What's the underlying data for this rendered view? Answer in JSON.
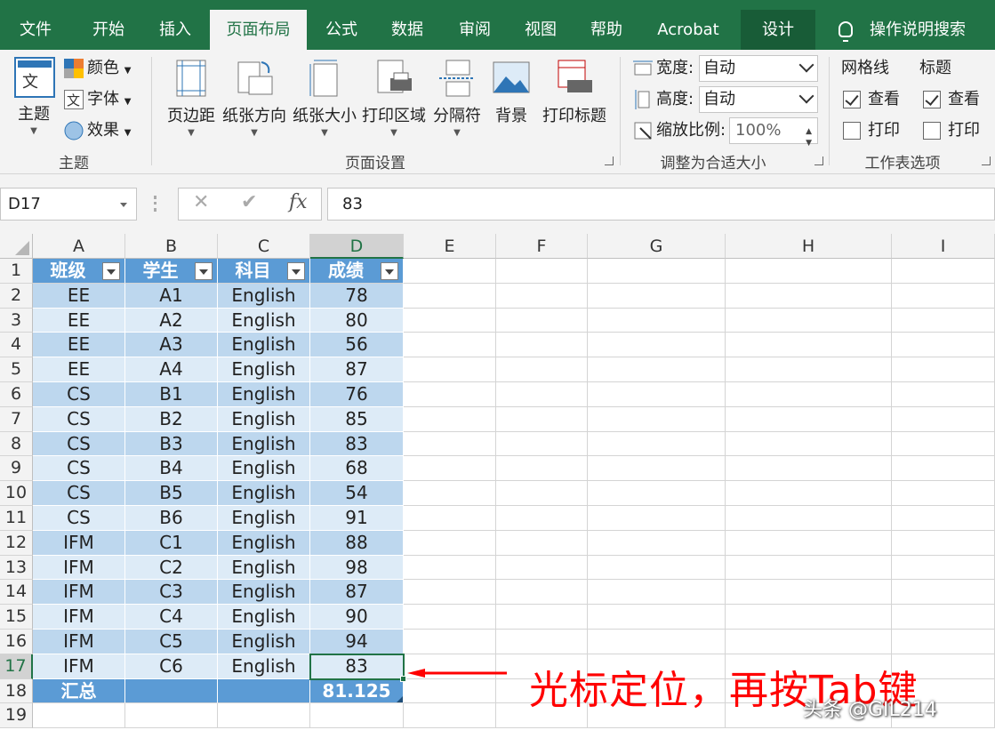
{
  "tabs": [
    {
      "label": "文件"
    },
    {
      "label": "开始"
    },
    {
      "label": "插入"
    },
    {
      "label": "页面布局"
    },
    {
      "label": "公式"
    },
    {
      "label": "数据"
    },
    {
      "label": "审阅"
    },
    {
      "label": "视图"
    },
    {
      "label": "帮助"
    },
    {
      "label": "Acrobat"
    },
    {
      "label": "设计"
    }
  ],
  "tell_me": "操作说明搜索",
  "ribbon": {
    "theme": {
      "themes": "主题",
      "colors": "颜色",
      "fonts": "字体",
      "effects": "效果",
      "group": "主题"
    },
    "page_setup": {
      "margins": "页边距",
      "orientation": "纸张方向",
      "size": "纸张大小",
      "print_area": "打印区域",
      "breaks": "分隔符",
      "background": "背景",
      "print_titles": "打印标题",
      "group": "页面设置"
    },
    "scale": {
      "width_label": "宽度:",
      "width_value": "自动",
      "height_label": "高度:",
      "height_value": "自动",
      "scale_label": "缩放比例:",
      "scale_value": "100%",
      "group": "调整为合适大小"
    },
    "sheet_options": {
      "gridlines": "网格线",
      "headings": "标题",
      "view": "查看",
      "print": "打印",
      "group": "工作表选项"
    }
  },
  "formula_bar": {
    "name_box": "D17",
    "formula": "83",
    "fx": "fx"
  },
  "columns": [
    "A",
    "B",
    "C",
    "D",
    "E",
    "F",
    "G",
    "H",
    "I"
  ],
  "rows": [
    "1",
    "2",
    "3",
    "4",
    "5",
    "6",
    "7",
    "8",
    "9",
    "10",
    "11",
    "12",
    "13",
    "14",
    "15",
    "16",
    "17",
    "18",
    "19"
  ],
  "table": {
    "headers": [
      "班级",
      "学生",
      "科目",
      "成绩"
    ],
    "data": [
      [
        "EE",
        "A1",
        "English",
        "78"
      ],
      [
        "EE",
        "A2",
        "English",
        "80"
      ],
      [
        "EE",
        "A3",
        "English",
        "56"
      ],
      [
        "EE",
        "A4",
        "English",
        "87"
      ],
      [
        "CS",
        "B1",
        "English",
        "76"
      ],
      [
        "CS",
        "B2",
        "English",
        "85"
      ],
      [
        "CS",
        "B3",
        "English",
        "83"
      ],
      [
        "CS",
        "B4",
        "English",
        "68"
      ],
      [
        "CS",
        "B5",
        "English",
        "54"
      ],
      [
        "CS",
        "B6",
        "English",
        "91"
      ],
      [
        "IFM",
        "C1",
        "English",
        "88"
      ],
      [
        "IFM",
        "C2",
        "English",
        "98"
      ],
      [
        "IFM",
        "C3",
        "English",
        "87"
      ],
      [
        "IFM",
        "C4",
        "English",
        "90"
      ],
      [
        "IFM",
        "C5",
        "English",
        "94"
      ],
      [
        "IFM",
        "C6",
        "English",
        "83"
      ]
    ],
    "total_label": "汇总",
    "total_value": "81.125"
  },
  "annotation": "光标定位，再按Tab键",
  "watermark": "头条 @GIL214",
  "colors": {
    "accent": "#217346",
    "table_header": "#5b9bd5",
    "band1": "#bdd7ee",
    "band2": "#ddebf7",
    "annotation": "#ff0000"
  }
}
